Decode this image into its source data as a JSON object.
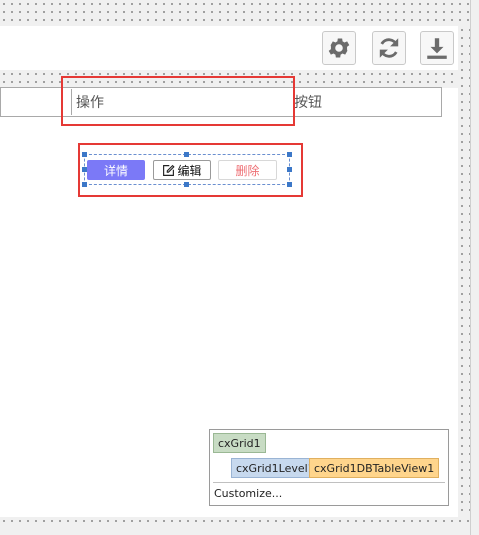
{
  "toolbar": {
    "settings_icon": "gear-icon",
    "refresh_icon": "refresh-icon",
    "download_icon": "download-icon",
    "icon_color": "#6b6b6b"
  },
  "grid_header": {
    "col_operation": "操作",
    "col_button": "按钮"
  },
  "row_buttons": {
    "detail": "详情",
    "edit": "编辑",
    "edit_icon": "edit-icon",
    "delete": "删除",
    "detail_color": "#7b79f7",
    "delete_color": "#ee6e73"
  },
  "component_popup": {
    "grid": "cxGrid1",
    "level": "cxGrid1Level1",
    "view": "cxGrid1DBTableView1",
    "customize": "Customize..."
  }
}
